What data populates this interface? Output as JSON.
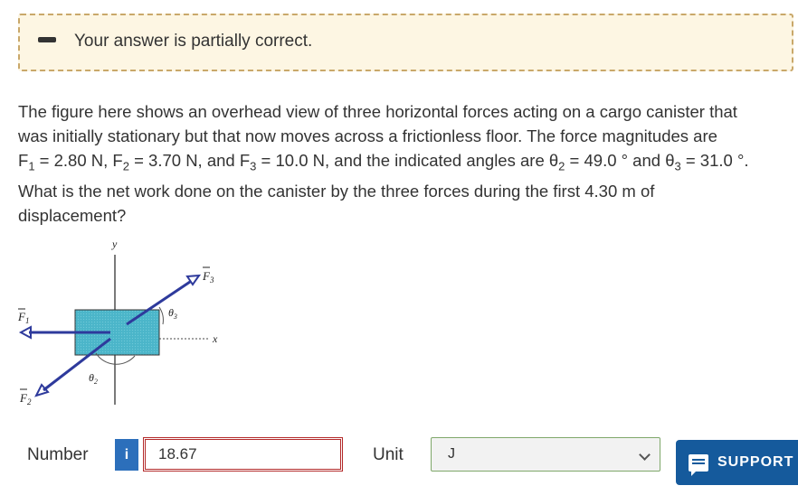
{
  "feedback": {
    "message": "Your answer is partially correct.",
    "icon": "minus-icon"
  },
  "question": {
    "line1": "The figure here shows an overhead view of three horizontal forces acting on a cargo canister that",
    "line2": "was initially stationary but that now moves across a frictionless floor. The force magnitudes are",
    "line3_parts": {
      "F1": "F",
      "F1_sub": "1",
      "F1_val": " = 2.80 N, ",
      "F2": "F",
      "F2_sub": "2",
      "F2_val": " = 3.70 N, and ",
      "F3": "F",
      "F3_sub": "3",
      "F3_val": " = 10.0 N, and the indicated angles are ",
      "theta2": "θ",
      "theta2_sub": "2",
      "theta2_val": " = 49.0 ° and ",
      "theta3": "θ",
      "theta3_sub": "3",
      "theta3_val": " = 31.0 °."
    },
    "line4": "What is the net work done on the canister by the three forces during the first 4.30 m of",
    "line5": "displacement?"
  },
  "figure": {
    "axis_y": "y",
    "axis_x": "x",
    "label_F1": "F",
    "label_F1_sub": "1",
    "label_F2": "F",
    "label_F2_sub": "2",
    "label_F3": "F",
    "label_F3_sub": "3",
    "label_theta2": "θ",
    "label_theta2_sub": "2",
    "label_theta3": "θ",
    "label_theta3_sub": "3",
    "canister_color": "#4bb5c9",
    "arrow_color": "#2e3a9c"
  },
  "answer": {
    "label": "Number",
    "info_icon": "i",
    "value": "18.67",
    "unit_label": "Unit",
    "unit_value": "J"
  },
  "support": {
    "label": "SUPPORT",
    "icon": "chat-icon"
  }
}
